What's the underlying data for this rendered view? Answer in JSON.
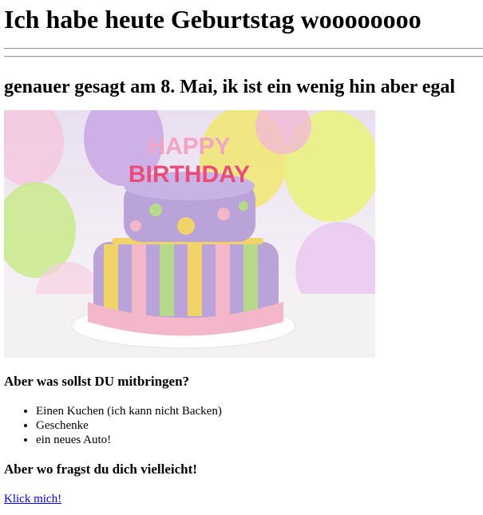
{
  "header": {
    "title": "Ich habe heute Geburtstag woooooooo"
  },
  "subtitle": "genauer gesagt am 8. Mai, ik ist ein wenig hin aber egal",
  "image": {
    "candle_text": "HAPPY BIRTHDAY"
  },
  "question_bring": "Aber was sollst DU mitbringen?",
  "gifts": [
    "Einen Kuchen (ich kann nicht Backen)",
    "Geschenke",
    "ein neues Auto!"
  ],
  "question_where": "Aber wo fragst du dich vielleicht!",
  "link_label": "Klick mich!",
  "colors": {
    "link": "#0000ee",
    "cake_purple": "#b9a3d9",
    "cake_pink": "#f4b6c9",
    "cake_yellow": "#f2d36a",
    "cake_green": "#b6d98a"
  }
}
